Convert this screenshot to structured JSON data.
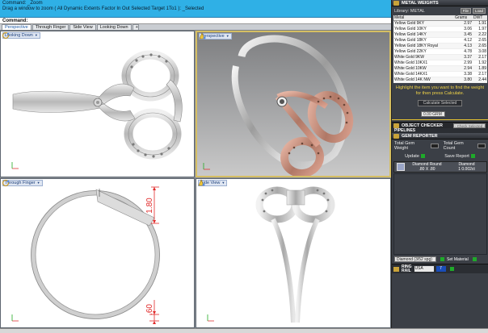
{
  "command": {
    "history": [
      "Command: _Zoom",
      "Drag a window to zoom ( All  Dynamic  Extents  Factor  In  Out  Selected  Target  1To1 ): _Selected"
    ],
    "prompt": "Command:"
  },
  "tabs": [
    {
      "label": "Perspective",
      "active": true
    },
    {
      "label": "Through Finger",
      "active": false
    },
    {
      "label": "Side View",
      "active": false
    },
    {
      "label": "Looking Down",
      "active": false
    }
  ],
  "tab_add": "+",
  "viewports": {
    "top_left": "Looking Down",
    "top_right": "Perspective",
    "bottom_left": "Through Finger",
    "bottom_right": "Side View"
  },
  "dimensions": {
    "top": "1.80",
    "bottom": ".60"
  },
  "panel": {
    "metal_weights_title": "METAL WEIGHTS",
    "library_label": "Library: METAL",
    "library_btn_1": "File",
    "library_btn_2": "Load",
    "columns": [
      "Metal",
      "Grams",
      "DWT"
    ],
    "metals": [
      {
        "name": "Yellow Gold 9KY",
        "grams": "2.97",
        "dwt": "1.91"
      },
      {
        "name": "Yellow Gold 10KY",
        "grams": "3.06",
        "dwt": "1.97"
      },
      {
        "name": "Yellow Gold 14KY",
        "grams": "3.45",
        "dwt": "2.22"
      },
      {
        "name": "Yellow Gold 18KY",
        "grams": "4.12",
        "dwt": "2.65"
      },
      {
        "name": "Yellow Gold 18KY Royal",
        "grams": "4.13",
        "dwt": "2.65"
      },
      {
        "name": "Yellow Gold 22KY",
        "grams": "4.78",
        "dwt": "3.08"
      },
      {
        "name": "White Gold 9KW",
        "grams": "3.37",
        "dwt": "2.17"
      },
      {
        "name": "White Gold 10KX1",
        "grams": "2.99",
        "dwt": "1.92"
      },
      {
        "name": "White Gold 10KW",
        "grams": "2.94",
        "dwt": "1.89"
      },
      {
        "name": "White Gold 14KX1",
        "grams": "3.38",
        "dwt": "2.17"
      },
      {
        "name": "White Gold 14K NW",
        "grams": "3.80",
        "dwt": "2.44"
      }
    ],
    "hint": "Highlight the item you want to find the weight for then press Calculate.",
    "calculate": "Calculate Selected",
    "grams_placeholder": "0.00 GRM",
    "object_checker": "OBJECT CHECKER",
    "object_checker_hint": "- Check Selected -",
    "pipeline_label": "PIPELINES",
    "gem_reporter": "GEM REPORTER",
    "total_gem_weight": "Total Gem Weight",
    "total_gem_count": "Total Gem Count",
    "update": "Update",
    "save_report": "Save Report",
    "gem_cols": [
      "Diamond Round",
      "Diamond"
    ],
    "gem_vals": [
      ".80 X .80",
      "1  0.002ct"
    ],
    "material_select": "Diamond   (3/52 spg)",
    "set_material": "Set Material",
    "ring_label": "RING\nRAIL",
    "ring_region": "USA",
    "ring_size": "7"
  },
  "colors": {
    "accent_cyan": "#2fb0e6",
    "panel_bg": "#3b3f46",
    "gold": "#e8c531",
    "rose_gold": "#c9907e",
    "dimension_red": "#e12a2a"
  }
}
